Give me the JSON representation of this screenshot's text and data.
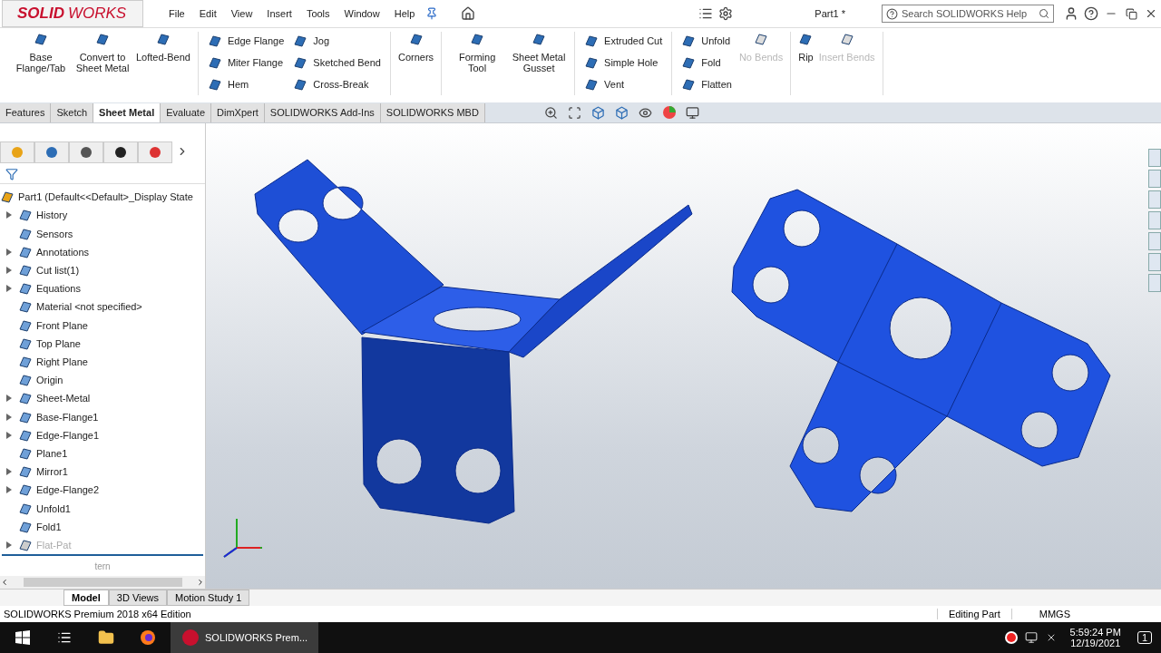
{
  "app": {
    "logo_prefix": "SOLID",
    "logo_suffix": "WORKS",
    "menus": [
      "File",
      "Edit",
      "View",
      "Insert",
      "Tools",
      "Window",
      "Help"
    ],
    "document_title": "Part1 *",
    "search": {
      "placeholder": "Search SOLIDWORKS Help"
    }
  },
  "ribbon": {
    "groups": [
      {
        "columns": [
          {
            "kind": "large",
            "items": [
              {
                "label": "Base Flange/Tab",
                "disabled": false
              }
            ]
          },
          {
            "kind": "large",
            "items": [
              {
                "label": "Convert to Sheet Metal",
                "disabled": false
              }
            ]
          },
          {
            "kind": "large",
            "items": [
              {
                "label": "Lofted-Bend",
                "disabled": false
              }
            ]
          }
        ]
      },
      {
        "columns": [
          {
            "kind": "small",
            "items": [
              {
                "label": "Edge Flange",
                "disabled": false
              },
              {
                "label": "Miter Flange",
                "disabled": false
              },
              {
                "label": "Hem",
                "disabled": false
              }
            ]
          },
          {
            "kind": "small",
            "items": [
              {
                "label": "Jog",
                "disabled": false
              },
              {
                "label": "Sketched Bend",
                "disabled": false
              },
              {
                "label": "Cross-Break",
                "disabled": false
              }
            ]
          }
        ]
      },
      {
        "columns": [
          {
            "kind": "large",
            "items": [
              {
                "label": "Corners",
                "disabled": false
              }
            ]
          }
        ]
      },
      {
        "columns": [
          {
            "kind": "large",
            "items": [
              {
                "label": "Forming Tool",
                "disabled": false
              }
            ]
          },
          {
            "kind": "large",
            "items": [
              {
                "label": "Sheet Metal Gusset",
                "disabled": false
              }
            ]
          }
        ]
      },
      {
        "columns": [
          {
            "kind": "small",
            "items": [
              {
                "label": "Extruded Cut",
                "disabled": false
              },
              {
                "label": "Simple Hole",
                "disabled": false
              },
              {
                "label": "Vent",
                "disabled": false
              }
            ]
          }
        ]
      },
      {
        "columns": [
          {
            "kind": "small",
            "items": [
              {
                "label": "Unfold",
                "disabled": false
              },
              {
                "label": "Fold",
                "disabled": false
              },
              {
                "label": "Flatten",
                "disabled": false
              }
            ]
          },
          {
            "kind": "large",
            "items": [
              {
                "label": "No Bends",
                "disabled": true
              }
            ]
          }
        ]
      },
      {
        "columns": [
          {
            "kind": "large",
            "items": [
              {
                "label": "Rip",
                "disabled": false
              }
            ]
          },
          {
            "kind": "large",
            "items": [
              {
                "label": "Insert Bends",
                "disabled": true
              }
            ]
          }
        ]
      }
    ]
  },
  "command_tabs": [
    {
      "label": "Features",
      "selected": false
    },
    {
      "label": "Sketch",
      "selected": false
    },
    {
      "label": "Sheet Metal",
      "selected": true
    },
    {
      "label": "Evaluate",
      "selected": false
    },
    {
      "label": "DimXpert",
      "selected": false
    },
    {
      "label": "SOLIDWORKS Add-Ins",
      "selected": false
    },
    {
      "label": "SOLIDWORKS MBD",
      "selected": false
    }
  ],
  "feature_tree": {
    "root": "Part1  (Default<<Default>_Display State",
    "items": [
      {
        "label": "History",
        "kind": "group",
        "disabled": false
      },
      {
        "label": "Sensors",
        "kind": "item",
        "disabled": false
      },
      {
        "label": "Annotations",
        "kind": "group",
        "disabled": false
      },
      {
        "label": "Cut list(1)",
        "kind": "group",
        "disabled": false
      },
      {
        "label": "Equations",
        "kind": "group",
        "disabled": false
      },
      {
        "label": "Material <not specified>",
        "kind": "item",
        "disabled": false
      },
      {
        "label": "Front Plane",
        "kind": "item",
        "disabled": false
      },
      {
        "label": "Top Plane",
        "kind": "item",
        "disabled": false
      },
      {
        "label": "Right Plane",
        "kind": "item",
        "disabled": false
      },
      {
        "label": "Origin",
        "kind": "item",
        "disabled": false
      },
      {
        "label": "Sheet-Metal",
        "kind": "group",
        "disabled": false
      },
      {
        "label": "Base-Flange1",
        "kind": "group",
        "disabled": false
      },
      {
        "label": "Edge-Flange1",
        "kind": "group",
        "disabled": false
      },
      {
        "label": "Plane1",
        "kind": "item",
        "disabled": false
      },
      {
        "label": "Mirror1",
        "kind": "group",
        "disabled": false
      },
      {
        "label": "Edge-Flange2",
        "kind": "group",
        "disabled": false
      },
      {
        "label": "Unfold1",
        "kind": "item",
        "disabled": false
      },
      {
        "label": "Fold1",
        "kind": "item",
        "disabled": false
      },
      {
        "label": "Flat-Pat",
        "kind": "group",
        "disabled": true
      }
    ],
    "footer": "tern"
  },
  "bottom_tabs": [
    {
      "label": "Model",
      "selected": true
    },
    {
      "label": "3D Views",
      "selected": false
    },
    {
      "label": "Motion Study 1",
      "selected": false
    }
  ],
  "status_bar": {
    "text": "SOLIDWORKS Premium 2018 x64 Edition",
    "mode": "Editing Part",
    "units": "MMGS"
  },
  "taskbar": {
    "app_label": "SOLIDWORKS Prem...",
    "time": "5:59:24 PM",
    "date": "12/19/2021",
    "notifications": "1"
  }
}
